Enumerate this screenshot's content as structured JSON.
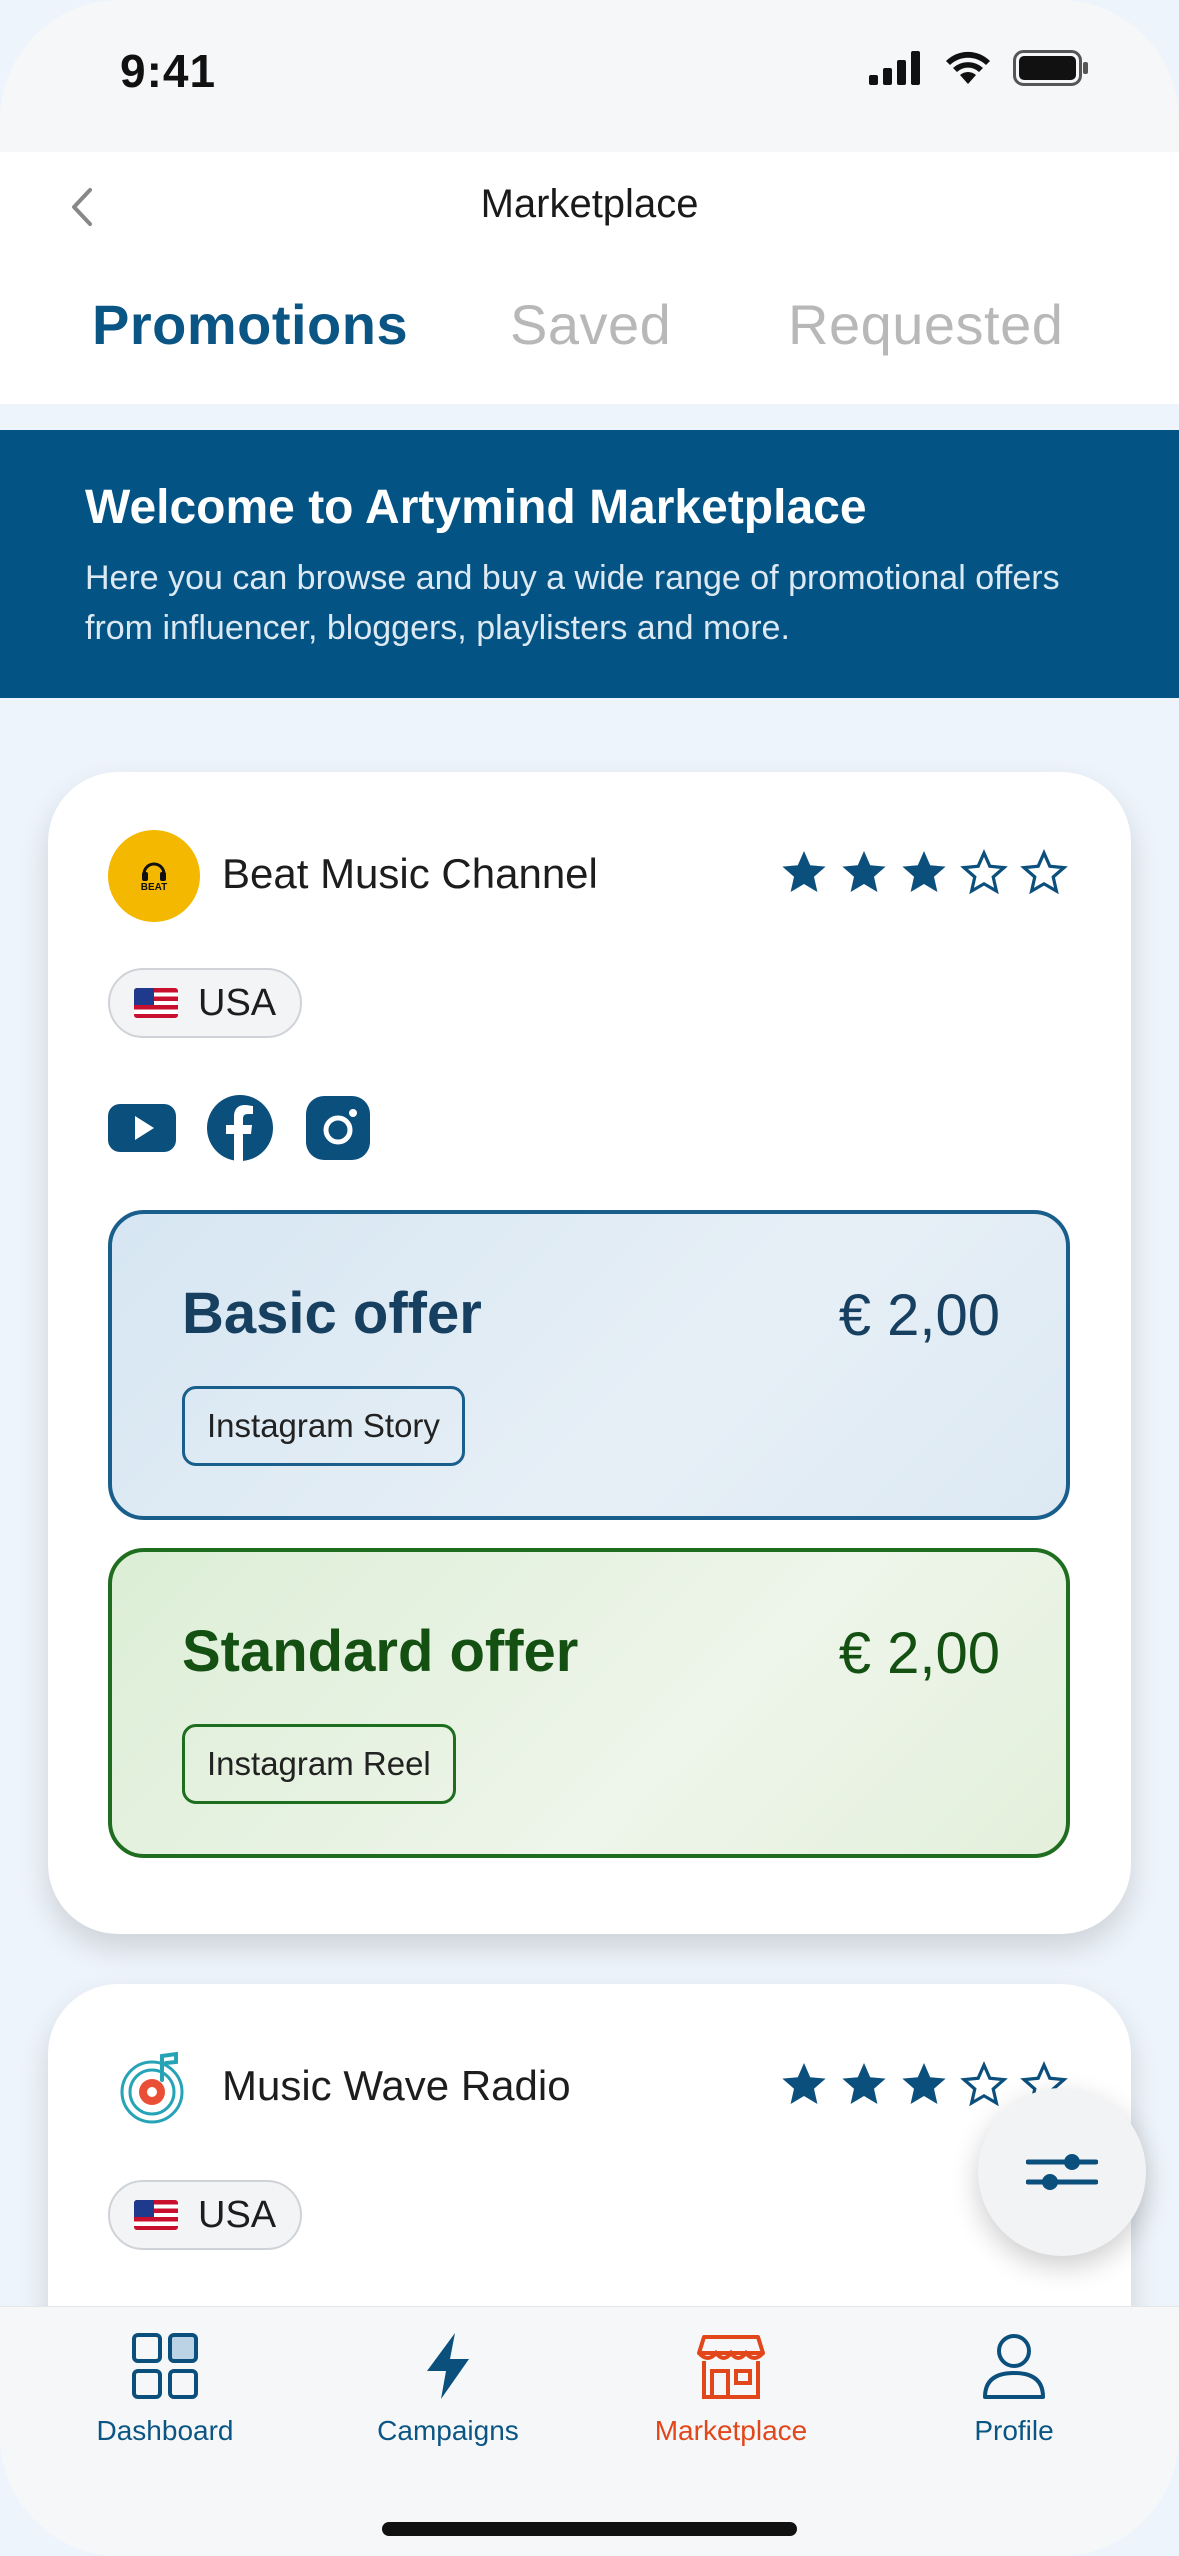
{
  "status_bar": {
    "time": "9:41"
  },
  "header": {
    "title": "Marketplace",
    "tabs": [
      {
        "label": "Promotions",
        "active": true
      },
      {
        "label": "Saved",
        "active": false
      },
      {
        "label": "Requested",
        "active": false
      }
    ]
  },
  "banner": {
    "title": "Welcome to Artymind Marketplace",
    "text": "Here you can browse and buy a wide range of promotional offers from influencer, bloggers, playlisters and more."
  },
  "sellers": [
    {
      "name": "Beat Music Channel",
      "logo_text": "BEAT",
      "rating": 3,
      "rating_max": 5,
      "country": "USA",
      "socials": [
        "youtube-icon",
        "facebook-icon",
        "instagram-icon"
      ],
      "offers": [
        {
          "title": "Basic offer",
          "price": "€ 2,00",
          "tag": "Instagram Story",
          "color": "#1a5f8c"
        },
        {
          "title": "Standard offer",
          "price": "€ 2,00",
          "tag": "Instagram Reel",
          "color": "#1f6d1f"
        }
      ]
    },
    {
      "name": "Music Wave Radio",
      "rating": 3,
      "rating_max": 5,
      "country": "USA"
    }
  ],
  "tabbar": {
    "items": [
      {
        "label": "Dashboard",
        "icon": "dashboard-icon"
      },
      {
        "label": "Campaigns",
        "icon": "lightning-icon"
      },
      {
        "label": "Marketplace",
        "icon": "store-icon",
        "active": true
      },
      {
        "label": "Profile",
        "icon": "person-icon"
      }
    ]
  },
  "colors": {
    "primary": "#035485",
    "accent": "#e2461b",
    "basic": "#1a5f8c",
    "standard": "#1f6d1f"
  }
}
